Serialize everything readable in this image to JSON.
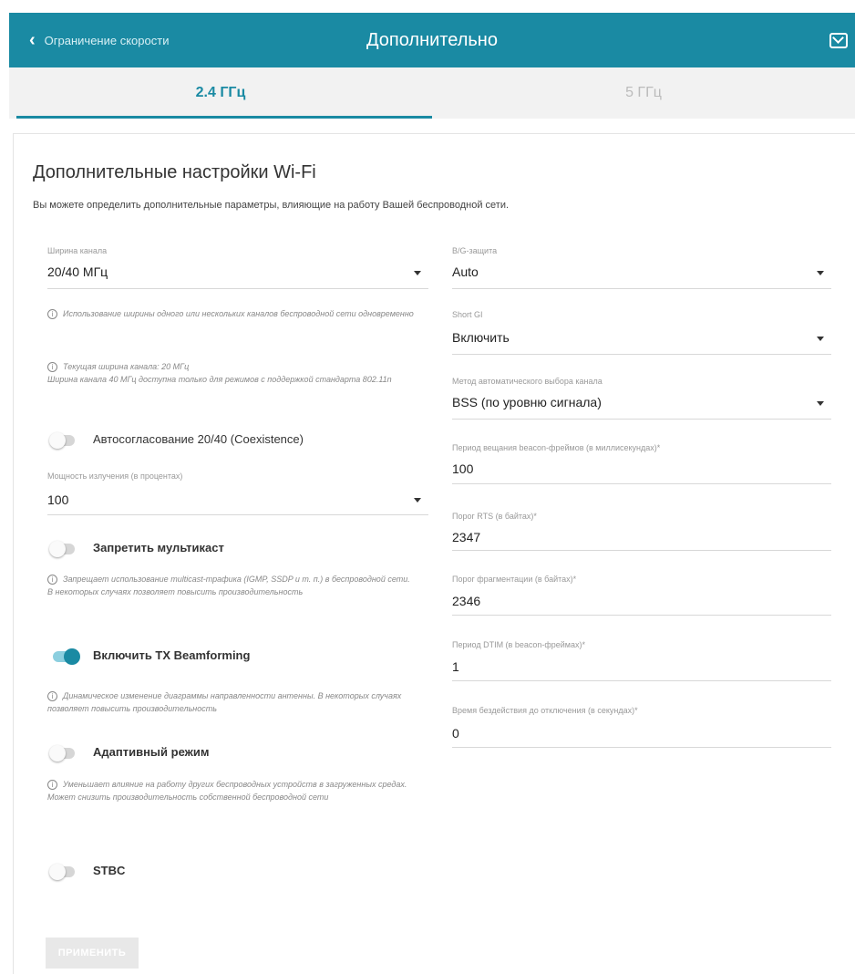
{
  "header": {
    "back_label": "Ограничение скорости",
    "title": "Дополнительно"
  },
  "tabs": [
    {
      "label": "2.4 ГГц",
      "active": true
    },
    {
      "label": "5 ГГц",
      "active": false
    }
  ],
  "section": {
    "title": "Дополнительные настройки Wi-Fi",
    "subtitle": "Вы можете определить дополнительные параметры, влияющие на работу Вашей беспроводной сети."
  },
  "left": {
    "channel_width": {
      "label": "Ширина канала",
      "value": "20/40 МГц"
    },
    "note_channel_usage": "Использование ширины одного или нескольких каналов беспроводной сети одновременно",
    "note_current_width_1": "Текущая ширина канала: 20 МГц",
    "note_current_width_2": "Ширина канала 40 МГц доступна только для режимов с поддержкой стандарта 802.11n",
    "coexistence": {
      "label": "Автосогласование 20/40 (Coexistence)",
      "on": false
    },
    "tx_power": {
      "label": "Мощность излучения (в процентах)",
      "value": "100"
    },
    "multicast": {
      "label": "Запретить мультикаст",
      "on": false
    },
    "note_multicast": "Запрещает использование multicast-трафика (IGMP, SSDP и т. п.) в беспроводной сети. В некоторых случаях позволяет повысить производительность",
    "beamforming": {
      "label": "Включить TX Beamforming",
      "on": true
    },
    "note_beamforming": "Динамическое изменение диаграммы направленности антенны. В некоторых случаях позволяет повысить производительность",
    "adaptive": {
      "label": "Адаптивный режим",
      "on": false
    },
    "note_adaptive": "Уменьшает влияние на работу других беспроводных устройств в загруженных средах. Может снизить производительность собственной беспроводной сети",
    "stbc": {
      "label": "STBC",
      "on": false
    }
  },
  "right": {
    "bg_protection": {
      "label": "B/G-защита",
      "value": "Auto"
    },
    "short_gi": {
      "label": "Short GI",
      "value": "Включить"
    },
    "auto_channel": {
      "label": "Метод автоматического выбора канала",
      "value": "BSS (по уровню сигнала)"
    },
    "beacon": {
      "label": "Период вещания beacon-фреймов (в миллисекундах)*",
      "value": "100"
    },
    "rts": {
      "label": "Порог RTS (в байтах)*",
      "value": "2347"
    },
    "frag": {
      "label": "Порог фрагментации (в байтах)*",
      "value": "2346"
    },
    "dtim": {
      "label": "Период DTIM (в beacon-фреймах)*",
      "value": "1"
    },
    "inactivity": {
      "label": "Время бездействия до отключения (в секундах)*",
      "value": "0"
    }
  },
  "apply_label": "ПРИМЕНИТЬ",
  "colors": {
    "accent": "#1a8aa3"
  }
}
